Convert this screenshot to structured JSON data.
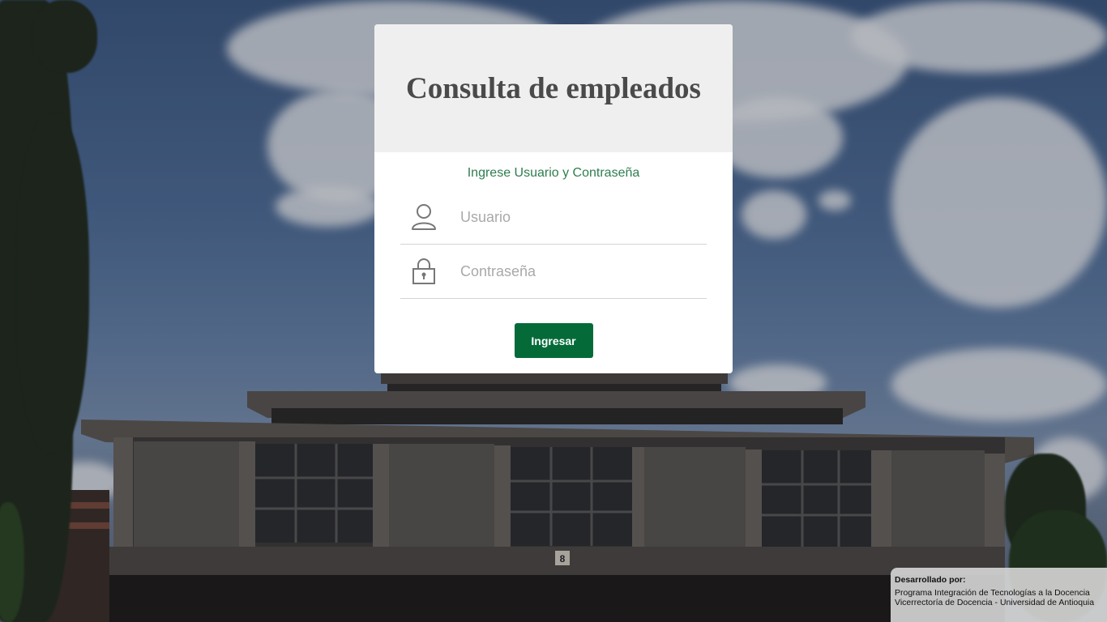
{
  "login": {
    "title": "Consulta de empleados",
    "subtitle": "Ingrese Usuario y Contraseña",
    "username_placeholder": "Usuario",
    "password_placeholder": "Contraseña",
    "submit_label": "Ingresar",
    "user_icon": "user-icon",
    "lock_icon": "lock-icon"
  },
  "credits": {
    "heading": "Desarrollado por:",
    "line1": "Programa Integración de Tecnologías a la Docencia",
    "line2": "Vicerrectoría de Docencia - Universidad de Antioquia"
  },
  "background": {
    "building_number": "8"
  },
  "colors": {
    "accent": "#046b38",
    "subtitle": "#2e7d4f",
    "card_header": "#efefef"
  }
}
